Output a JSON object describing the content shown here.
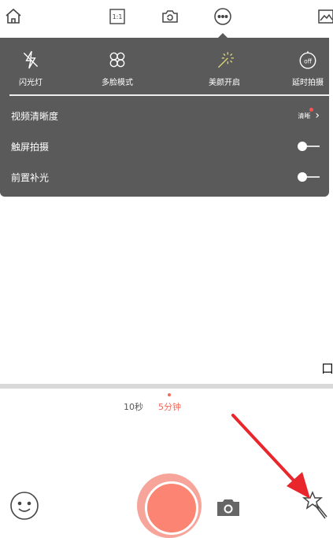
{
  "panel": {
    "modes": [
      {
        "label": "闪光灯",
        "icon": "flash-icon"
      },
      {
        "label": "多脸模式",
        "icon": "multi-face-icon"
      },
      {
        "label": "美颜开启",
        "icon": "magic-wand-icon"
      },
      {
        "label": "延时拍摄",
        "icon": "timer-off-icon"
      }
    ],
    "settings": [
      {
        "label": "视频清晰度",
        "value": "清晰"
      },
      {
        "label": "触屏拍摄"
      },
      {
        "label": "前置补光"
      }
    ]
  },
  "toolbar": {
    "aspect_label": "1:1"
  },
  "grid_mark": "口",
  "durations": [
    {
      "label": "10秒",
      "color": "#555555"
    },
    {
      "label": "5分钟",
      "color": "#f36a5c"
    }
  ],
  "colors": {
    "accent": "#f36a5c",
    "panel_bg": "#5a5a5a",
    "record": "#fb8572"
  }
}
